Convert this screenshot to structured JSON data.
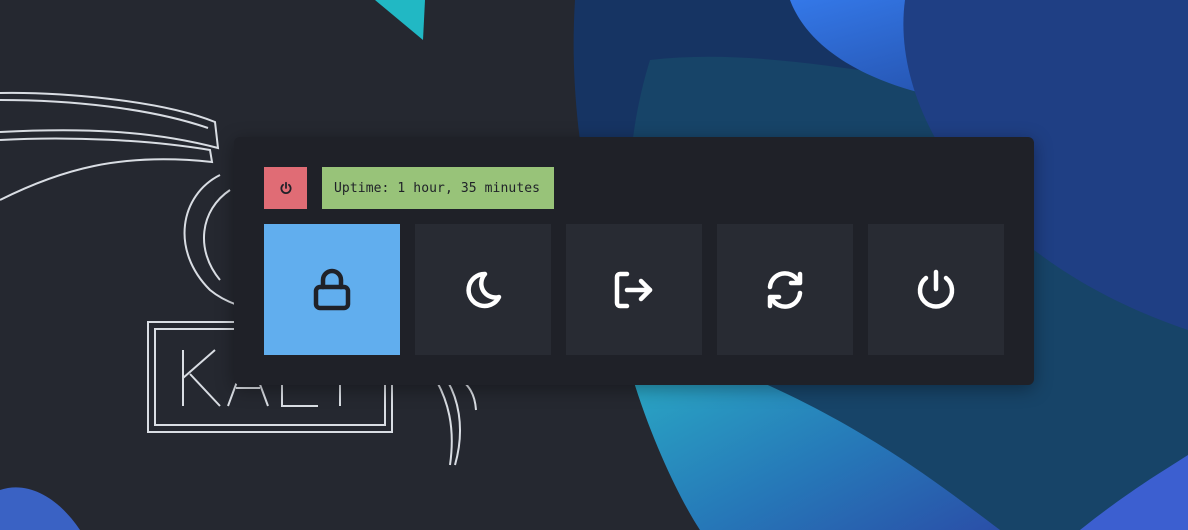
{
  "status": {
    "uptime": "Uptime: 1 hour, 35 minutes",
    "power_icon": "power-icon"
  },
  "actions": [
    {
      "id": "lock",
      "icon": "lock-icon",
      "selected": true
    },
    {
      "id": "suspend",
      "icon": "moon-icon",
      "selected": false
    },
    {
      "id": "logout",
      "icon": "logout-icon",
      "selected": false
    },
    {
      "id": "reboot",
      "icon": "reboot-icon",
      "selected": false
    },
    {
      "id": "shutdown",
      "icon": "power-icon",
      "selected": false
    }
  ],
  "colors": {
    "background": "#252830",
    "panel": "#1f2128",
    "button": "#282b33",
    "selected": "#61aeee",
    "danger": "#e06c75",
    "uptime": "#98c379",
    "icon": "#ffffff",
    "icon_selected": "#1f2128"
  }
}
